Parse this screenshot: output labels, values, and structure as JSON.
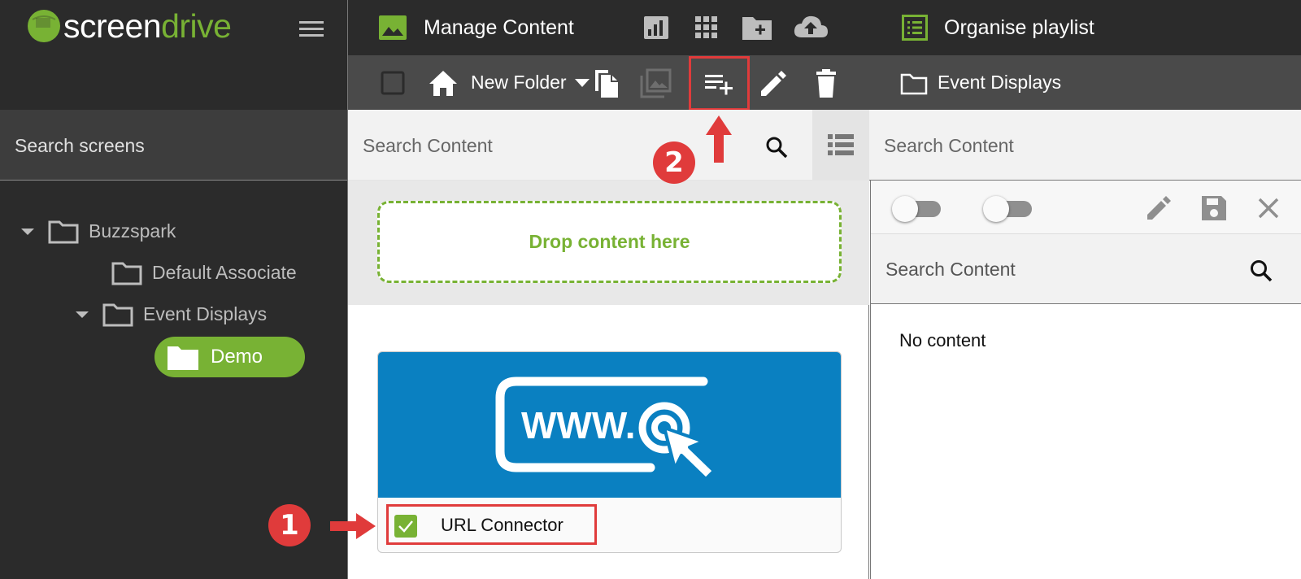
{
  "brand": {
    "name_part1": "screen",
    "name_part2": "drive",
    "accent": "#78b234",
    "annotation_red": "#e03b3b"
  },
  "sidebar": {
    "search_placeholder": "Search screens",
    "tree": [
      {
        "label": "Buzzspark",
        "expanded": true
      },
      {
        "label": "Default Associate"
      },
      {
        "label": "Event Displays",
        "expanded": true
      },
      {
        "label": "Demo",
        "selected": true
      }
    ]
  },
  "manage": {
    "title": "Manage Content",
    "new_folder_label": "New Folder",
    "search_placeholder": "Search Content",
    "drop_label": "Drop content here",
    "items": [
      {
        "name": "URL Connector",
        "checked": true,
        "thumb_text": "WWW."
      }
    ]
  },
  "playlist": {
    "title": "Organise playlist",
    "breadcrumb": "Event Displays",
    "search_placeholder": "Search Content",
    "inner_search_placeholder": "Search Content",
    "empty_text": "No content"
  },
  "annotations": {
    "step1": "1",
    "step2": "2"
  }
}
